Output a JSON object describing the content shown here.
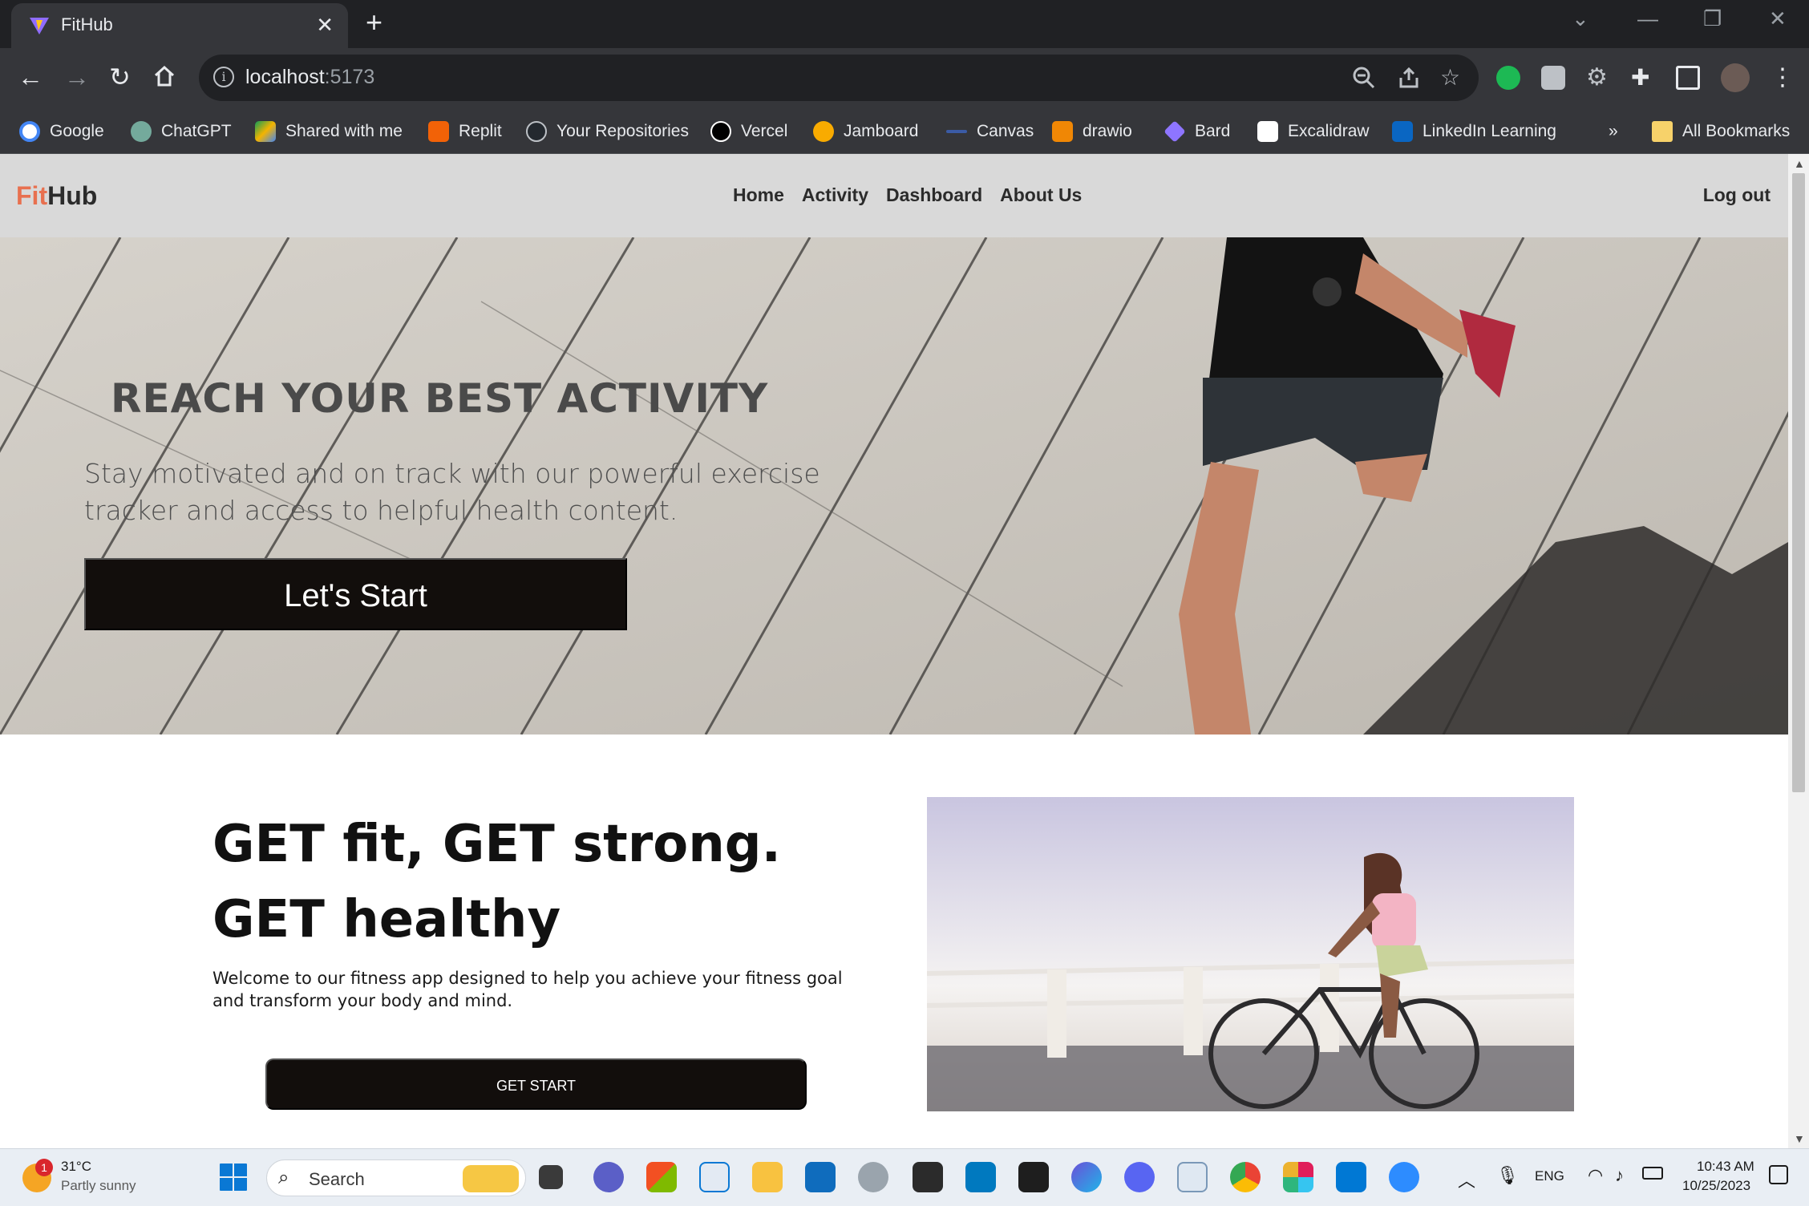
{
  "browser": {
    "tab_title": "FitHub",
    "url_host": "localhost",
    "url_port": ":5173",
    "bookmarks": [
      {
        "label": "Google",
        "color": "#ffffff"
      },
      {
        "label": "ChatGPT",
        "color": "#74aa9c"
      },
      {
        "label": "Shared with me",
        "color": "#f4b400"
      },
      {
        "label": "Replit",
        "color": "#f26207"
      },
      {
        "label": "Your Repositories",
        "color": "#24292f"
      },
      {
        "label": "Vercel",
        "color": "#000000"
      },
      {
        "label": "Jamboard",
        "color": "#f9ab00"
      },
      {
        "label": "Canvas",
        "color": "#3b5ba5"
      },
      {
        "label": "drawio",
        "color": "#f08705"
      },
      {
        "label": "Bard",
        "color": "#8e75ff"
      },
      {
        "label": "Excalidraw",
        "color": "#ffffff"
      },
      {
        "label": "LinkedIn Learning",
        "color": "#0a66c2"
      }
    ],
    "bookmarks_overflow": "»",
    "all_bookmarks": "All Bookmarks"
  },
  "site": {
    "logo_accent": "Fit",
    "logo_rest": "Hub",
    "nav": [
      "Home",
      "Activity",
      "Dashboard",
      "About Us"
    ],
    "logout": "Log out",
    "hero": {
      "title": "REACH YOUR BEST ACTIVITY",
      "subtitle": "Stay motivated and on track with our powerful exercise tracker and access to helpful health content.",
      "cta": "Let's Start"
    },
    "section": {
      "headline_line1": "GET fit, GET strong.",
      "headline_line2": "GET healthy",
      "intro": "Welcome to our fitness app designed to help you achieve your fitness goal and transform your body and mind.",
      "cta": "GET START"
    },
    "colors": {
      "accent": "#e8704f",
      "button": "#120e0c",
      "nav_bg": "#d9d9d9"
    }
  },
  "taskbar": {
    "weather_temp": "31°C",
    "weather_desc": "Partly sunny",
    "weather_badge": "1",
    "search_label": "Search",
    "language": "ENG",
    "time": "10:43 AM",
    "date": "10/25/2023"
  }
}
